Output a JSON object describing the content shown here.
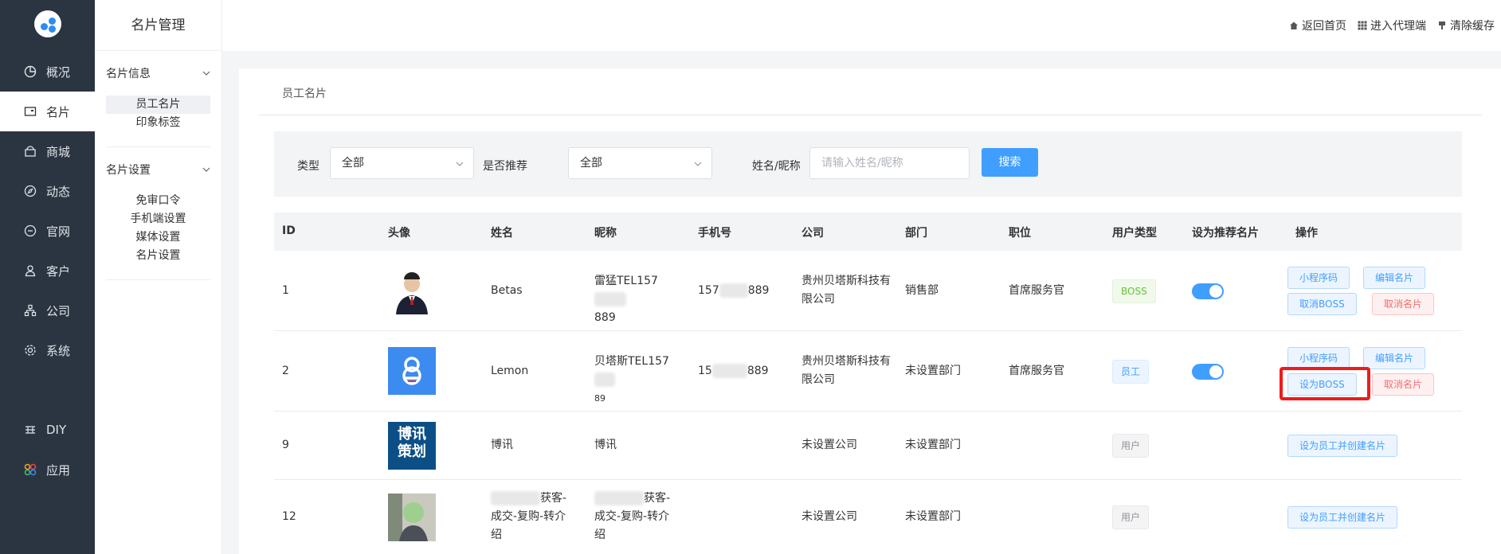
{
  "nav": {
    "items": [
      {
        "label": "概况",
        "icon": "pie-chart-icon"
      },
      {
        "label": "名片",
        "icon": "card-icon"
      },
      {
        "label": "商城",
        "icon": "shop-icon"
      },
      {
        "label": "动态",
        "icon": "compass-icon"
      },
      {
        "label": "官网",
        "icon": "website-icon"
      },
      {
        "label": "客户",
        "icon": "user-icon"
      },
      {
        "label": "公司",
        "icon": "org-icon"
      },
      {
        "label": "系统",
        "icon": "gear-icon"
      },
      {
        "label": "DIY",
        "icon": "diy-icon"
      },
      {
        "label": "应用",
        "icon": "apps-icon"
      }
    ],
    "active": "名片"
  },
  "subnav": {
    "title": "名片管理",
    "groups": [
      {
        "label": "名片信息",
        "items": [
          "员工名片",
          "印象标签"
        ]
      },
      {
        "label": "名片设置",
        "items": [
          "免审口令",
          "手机端设置",
          "媒体设置",
          "名片设置"
        ]
      }
    ],
    "active_item": "员工名片"
  },
  "topbar": {
    "links": [
      "返回首页",
      "进入代理端",
      "清除缓存"
    ]
  },
  "page": {
    "tab_title": "员工名片"
  },
  "filter": {
    "type_label": "类型",
    "type_value": "全部",
    "recommend_label": "是否推荐",
    "recommend_value": "全部",
    "name_label": "姓名/昵称",
    "name_placeholder": "请输入姓名/昵称",
    "search_button": "搜索"
  },
  "table": {
    "headers": [
      "ID",
      "头像",
      "姓名",
      "昵称",
      "手机号",
      "公司",
      "部门",
      "职位",
      "用户类型",
      "设为推荐名片",
      "操作"
    ],
    "rows": [
      {
        "id": "1",
        "name": "Betas",
        "nickname_a": "雷猛TEL157",
        "nickname_b": "889",
        "phone_a": "157",
        "phone_b": "889",
        "company": "贵州贝塔斯科技有限公司",
        "department": "销售部",
        "position": "首席服务官",
        "user_type": "BOSS",
        "recommended": true,
        "actions": [
          "小程序码",
          "编辑名片",
          "取消BOSS",
          "取消名片"
        ]
      },
      {
        "id": "2",
        "name": "Lemon",
        "nickname_a": "贝塔斯TEL157",
        "nickname_b": "89",
        "phone_a": "15",
        "phone_b": "889",
        "company": "贵州贝塔斯科技有限公司",
        "department": "未设置部门",
        "position": "首席服务官",
        "user_type": "员工",
        "recommended": true,
        "actions": [
          "小程序码",
          "编辑名片",
          "设为BOSS",
          "取消名片"
        ]
      },
      {
        "id": "9",
        "name": "博讯",
        "nickname": "博讯",
        "company": "未设置公司",
        "department": "未设置部门",
        "user_type": "用户",
        "actions": [
          "设为员工并创建名片"
        ],
        "avatar_text": [
          "博讯",
          "策划"
        ]
      },
      {
        "id": "12",
        "name_a": "获客-",
        "name_b": "成交-复购-转介",
        "name_c": "绍",
        "nickname_a": "获客-",
        "nickname_b": "成交-复购-转介",
        "nickname_c": "绍",
        "company": "未设置公司",
        "department": "未设置部门",
        "user_type": "用户",
        "actions": [
          "设为员工并创建名片"
        ]
      }
    ]
  }
}
